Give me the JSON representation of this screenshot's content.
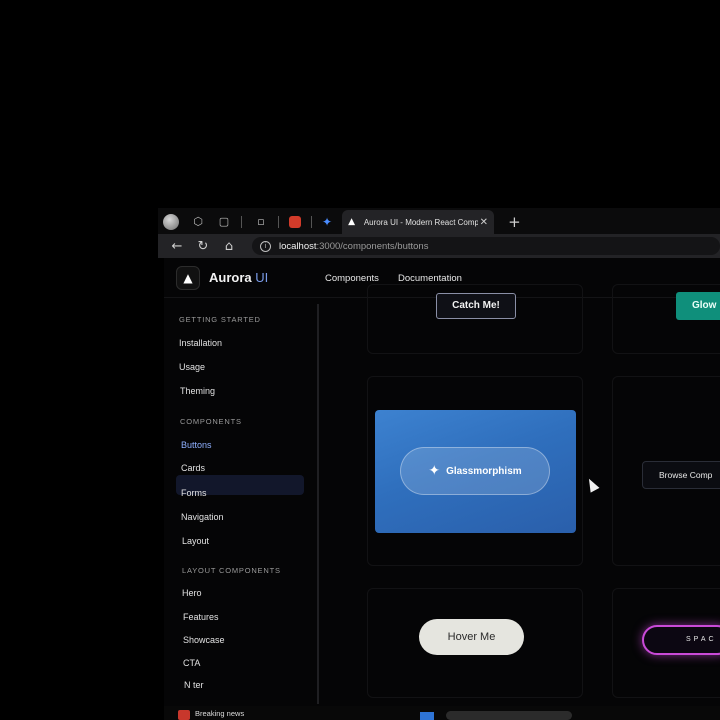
{
  "browser": {
    "active_tab_title": "Aurora UI - Modern React Compo",
    "active_tab_favicon": "▲",
    "url_host": "localhost",
    "url_path": ":3000/components/buttons",
    "new_tab": "+",
    "tab_close": "✕"
  },
  "site": {
    "logo_mark": "▲",
    "logo_name": "Aurora",
    "logo_suffix": " UI",
    "nav": [
      "Components",
      "Documentation"
    ]
  },
  "sidebar": {
    "sections": [
      {
        "title": "GETTING STARTED",
        "items": [
          "Installation",
          "Usage",
          "Theming"
        ]
      },
      {
        "title": "COMPONENTS",
        "items": [
          "Buttons",
          "Cards",
          "Forms",
          "Navigation",
          "Layout"
        ]
      },
      {
        "title": "LAYOUT COMPONENTS",
        "items": [
          "Hero",
          "Features",
          "Showcase",
          "CTA",
          "N  ter"
        ]
      }
    ],
    "active_item": "Buttons"
  },
  "content": {
    "catch_button": "Catch Me!",
    "glow_button": "Glow",
    "glass_button": "Glassmorphism",
    "glass_icon": "✦",
    "browse_button": "Browse Comp",
    "hover_button": "Hover Me",
    "space_button": "SPAC"
  },
  "taskbar": {
    "news": "Breaking news"
  },
  "colors": {
    "glass_card": "#2f6fbd",
    "glow": "#0f8f7b",
    "space_border": "#c94ad8",
    "active_sidebar": "#12172b"
  }
}
